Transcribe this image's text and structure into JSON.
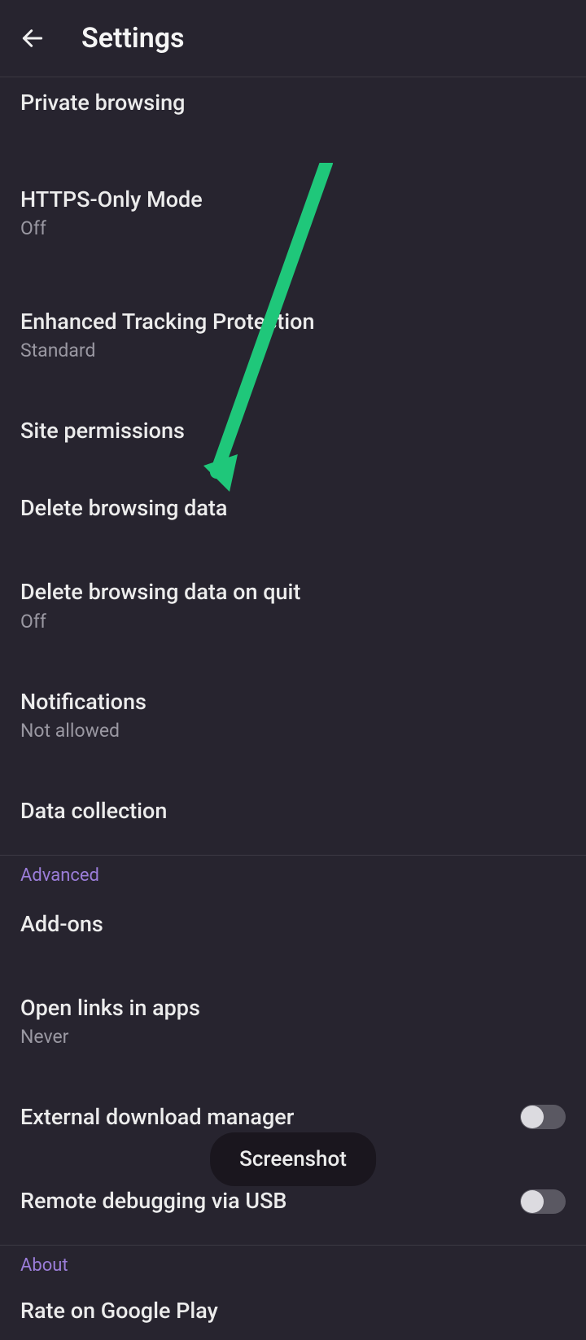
{
  "header": {
    "title": "Settings"
  },
  "settings": {
    "private_browsing": {
      "title": "Private browsing"
    },
    "https_only": {
      "title": "HTTPS-Only Mode",
      "subtitle": "Off"
    },
    "etp": {
      "title": "Enhanced Tracking Protection",
      "subtitle": "Standard"
    },
    "site_permissions": {
      "title": "Site permissions"
    },
    "delete_browsing_data": {
      "title": "Delete browsing data"
    },
    "delete_on_quit": {
      "title": "Delete browsing data on quit",
      "subtitle": "Off"
    },
    "notifications": {
      "title": "Notifications",
      "subtitle": "Not allowed"
    },
    "data_collection": {
      "title": "Data collection"
    }
  },
  "sections": {
    "advanced": "Advanced",
    "about": "About"
  },
  "advanced": {
    "addons": {
      "title": "Add-ons"
    },
    "open_links_in_apps": {
      "title": "Open links in apps",
      "subtitle": "Never"
    },
    "external_download_manager": {
      "title": "External download manager"
    },
    "remote_debugging": {
      "title": "Remote debugging via USB"
    }
  },
  "about": {
    "rate": {
      "title": "Rate on Google Play"
    }
  },
  "toast": {
    "text": "Screenshot"
  },
  "annotation": {
    "arrow_color": "#1fc77a"
  }
}
